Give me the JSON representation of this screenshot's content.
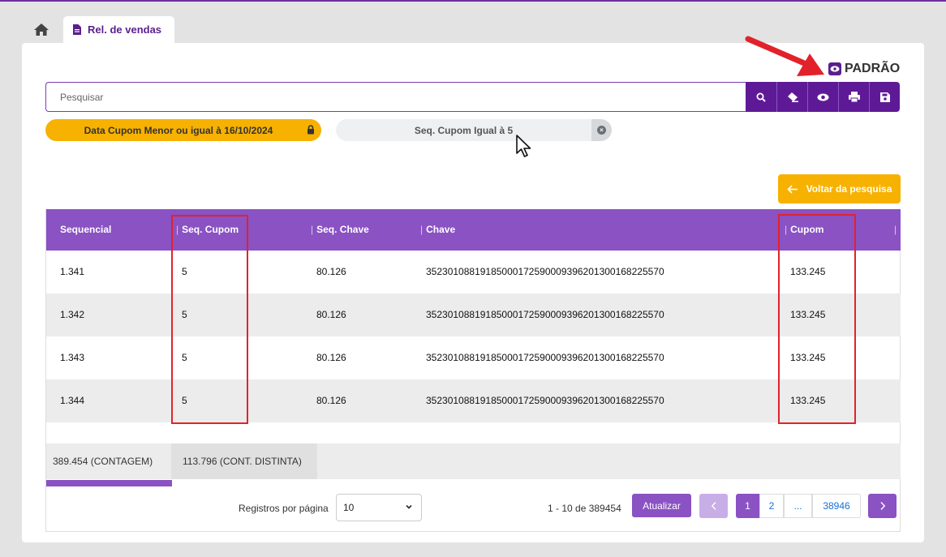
{
  "tabs": {
    "home_icon": "home-icon",
    "active_label": "Rel. de vendas",
    "active_icon": "document-icon"
  },
  "view": {
    "label": "PADRÃO",
    "icon": "eye-icon"
  },
  "search": {
    "placeholder": "Pesquisar",
    "value": ""
  },
  "toolbar": [
    {
      "name": "search-button",
      "icon": "search-icon"
    },
    {
      "name": "clear-button",
      "icon": "eraser-icon"
    },
    {
      "name": "view-button",
      "icon": "eye-icon"
    },
    {
      "name": "print-button",
      "icon": "print-icon"
    },
    {
      "name": "save-button",
      "icon": "save-icon"
    }
  ],
  "filters": {
    "date": {
      "label": "Data Cupom Menor ou igual à 16/10/2024",
      "icon": "lock-icon"
    },
    "seq": {
      "label": "Seq. Cupom Igual à 5",
      "icon": "close-icon"
    }
  },
  "back_button": {
    "label": "Voltar da pesquisa",
    "icon": "arrow-left-icon"
  },
  "table": {
    "columns": [
      "Sequencial",
      "Seq. Cupom",
      "Seq. Chave",
      "Chave",
      "Cupom"
    ],
    "rows": [
      [
        "1.341",
        "5",
        "80.126",
        "35230108819185000172590009396201300168225570",
        "133.245"
      ],
      [
        "1.342",
        "5",
        "80.126",
        "35230108819185000172590009396201300168225570",
        "133.245"
      ],
      [
        "1.343",
        "5",
        "80.126",
        "35230108819185000172590009396201300168225570",
        "133.245"
      ],
      [
        "1.344",
        "5",
        "80.126",
        "35230108819185000172590009396201300168225570",
        "133.245"
      ]
    ],
    "footer": {
      "count": "389.454 (CONTAGEM)",
      "distinct": "113.796 (CONT. DISTINTA)"
    }
  },
  "pagination": {
    "rows_label": "Registros por página",
    "rows_value": "10",
    "range": "1 - 10 de 389454",
    "refresh_label": "Atualizar",
    "prev": "‹",
    "pages": [
      "1",
      "2",
      "...",
      "38946"
    ],
    "next": "›"
  },
  "colors": {
    "primary": "#5e1a96",
    "header": "#8a52c3",
    "accent": "#f7b100",
    "highlight": "#e2222b"
  }
}
